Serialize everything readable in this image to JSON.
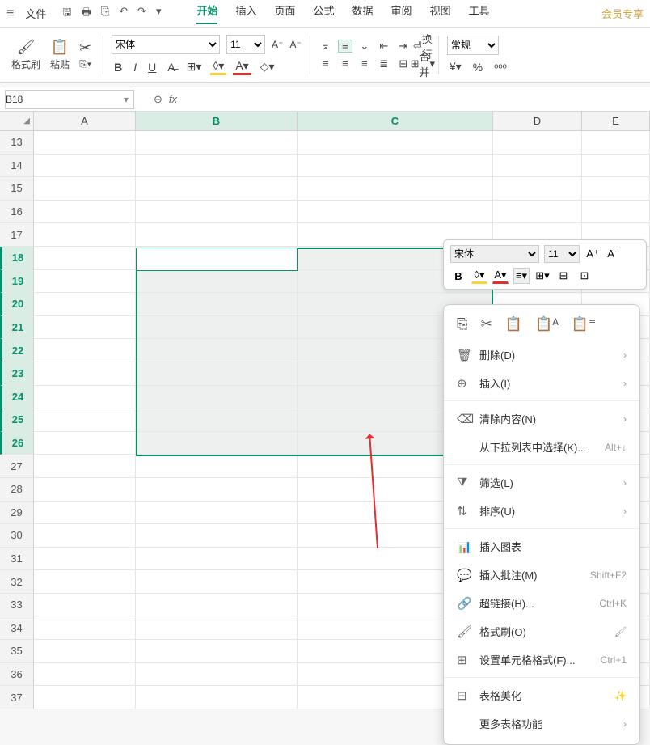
{
  "topbar": {
    "file": "文件",
    "tabs": [
      "开始",
      "插入",
      "页面",
      "公式",
      "数据",
      "审阅",
      "视图",
      "工具"
    ],
    "active_tab": 0,
    "member": "会员专享"
  },
  "ribbon": {
    "format_painter": "格式刷",
    "paste": "粘贴",
    "font_name": "宋体",
    "font_size": "11",
    "wrap": "换行",
    "merge": "合并",
    "number_format": "常规"
  },
  "namebox": {
    "ref": "B18"
  },
  "columns": [
    "A",
    "B",
    "C",
    "D",
    "E"
  ],
  "rows_start": 13,
  "rows_end": 37,
  "selection": {
    "rows": [
      18,
      26
    ],
    "cols": [
      "B",
      "C"
    ],
    "active": "B18"
  },
  "minitool": {
    "font_name": "宋体",
    "font_size": "11"
  },
  "ctx": {
    "delete": "删除(D)",
    "insert": "插入(I)",
    "clear": "清除内容(N)",
    "dropdown": "从下拉列表中选择(K)...",
    "dropdown_sc": "Alt+↓",
    "filter": "筛选(L)",
    "sort": "排序(U)",
    "chart": "插入图表",
    "comment": "插入批注(M)",
    "comment_sc": "Shift+F2",
    "hyperlink": "超链接(H)...",
    "hyperlink_sc": "Ctrl+K",
    "painter": "格式刷(O)",
    "cellformat": "设置单元格格式(F)...",
    "cellformat_sc": "Ctrl+1",
    "beautify": "表格美化",
    "more": "更多表格功能"
  }
}
